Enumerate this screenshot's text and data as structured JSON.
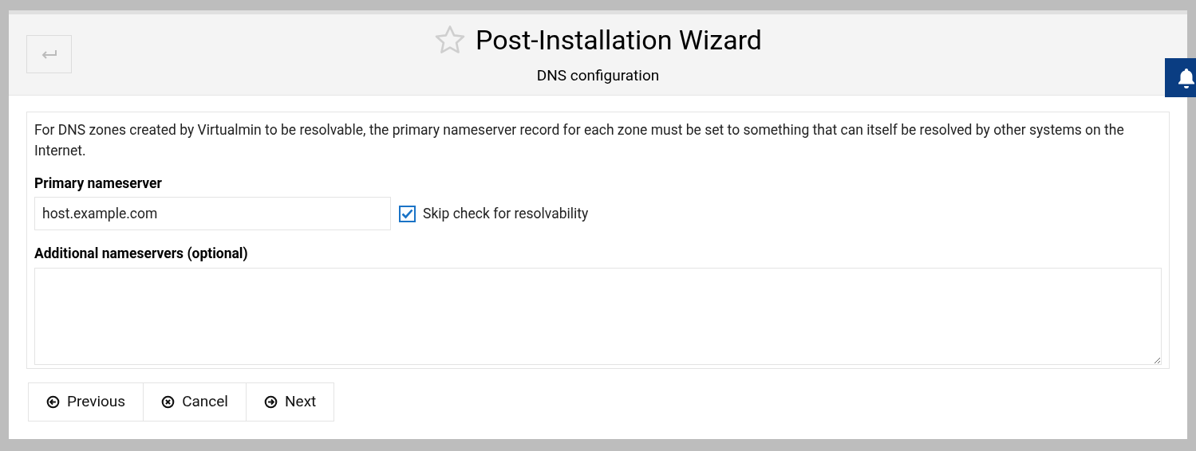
{
  "header": {
    "title": "Post-Installation Wizard",
    "subtitle": "DNS configuration",
    "favorite": false
  },
  "intro": "For DNS zones created by Virtualmin to be resolvable, the primary nameserver record for each zone must be set to something that can itself be resolved by other systems on the Internet.",
  "primary": {
    "label": "Primary nameserver",
    "value": "host.example.com"
  },
  "skip_check": {
    "label": "Skip check for resolvability",
    "checked": true
  },
  "additional": {
    "label": "Additional nameservers (optional)"
  },
  "buttons": [
    {
      "kind": "previous",
      "label": "Previous"
    },
    {
      "kind": "cancel",
      "label": "Cancel"
    },
    {
      "kind": "next",
      "label": "Next"
    }
  ]
}
